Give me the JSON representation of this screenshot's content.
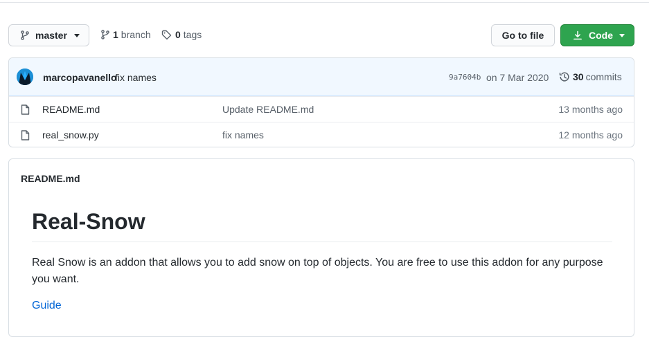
{
  "branch_bar": {
    "branch_name": "master",
    "branches_count": "1",
    "branches_label": "branch",
    "tags_count": "0",
    "tags_label": "tags",
    "goto_file_label": "Go to file",
    "code_label": "Code",
    "code_button_color": "#2ea44f"
  },
  "latest_commit": {
    "author": "marcopavanello",
    "message": "fix names",
    "sha": "9a7604b",
    "date": "on 7 Mar 2020",
    "commits_count": "30",
    "commits_label": "commits"
  },
  "files": [
    {
      "name": "README.md",
      "commit_message": "Update README.md",
      "age": "13 months ago",
      "icon": "file-icon"
    },
    {
      "name": "real_snow.py",
      "commit_message": "fix names",
      "age": "12 months ago",
      "icon": "file-icon"
    }
  ],
  "readme": {
    "filename": "README.md",
    "title": "Real-Snow",
    "description": "Real Snow is an addon that allows you to add snow on top of objects. You are free to use this addon for any purpose you want.",
    "link_label": "Guide",
    "link_color": "#0366d6"
  }
}
